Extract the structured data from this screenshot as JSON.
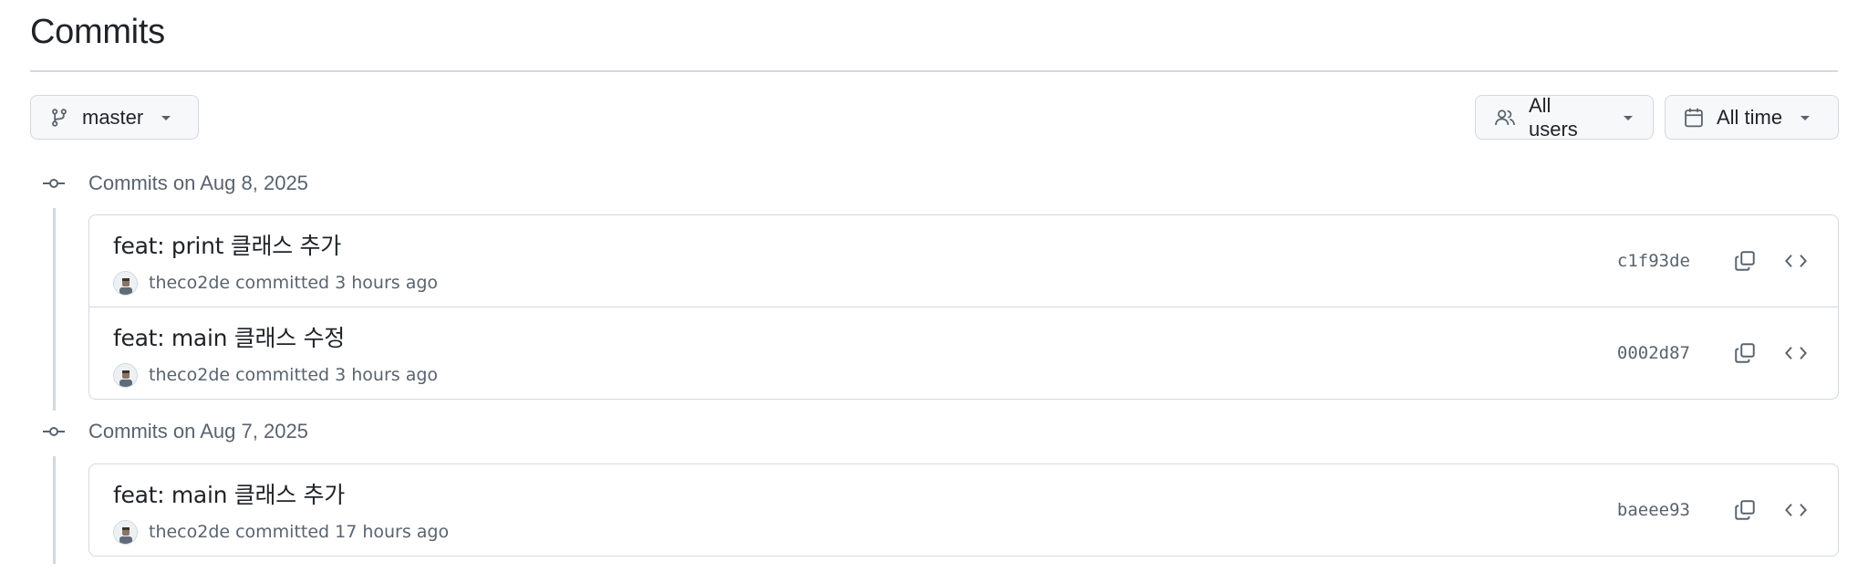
{
  "header": {
    "title": "Commits"
  },
  "filters": {
    "branch": {
      "label": "master",
      "icon": "git-branch-icon"
    },
    "users": {
      "label": "All users",
      "icon": "people-icon"
    },
    "time": {
      "label": "All time",
      "icon": "calendar-icon"
    }
  },
  "groups": [
    {
      "label": "Commits on Aug 8, 2025",
      "commits": [
        {
          "title": "feat: print 클래스 추가",
          "author": "theco2de",
          "action": "committed",
          "time": "3 hours ago",
          "sha": "c1f93de"
        },
        {
          "title": "feat: main 클래스 수정",
          "author": "theco2de",
          "action": "committed",
          "time": "3 hours ago",
          "sha": "0002d87"
        }
      ]
    },
    {
      "label": "Commits on Aug 7, 2025",
      "commits": [
        {
          "title": "feat: main 클래스 추가",
          "author": "theco2de",
          "action": "committed",
          "time": "17 hours ago",
          "sha": "baeee93"
        }
      ]
    }
  ],
  "colors": {
    "border": "#d1d9e0",
    "muted": "#59636e",
    "text": "#1f2328",
    "button_bg": "#f6f8fa"
  }
}
